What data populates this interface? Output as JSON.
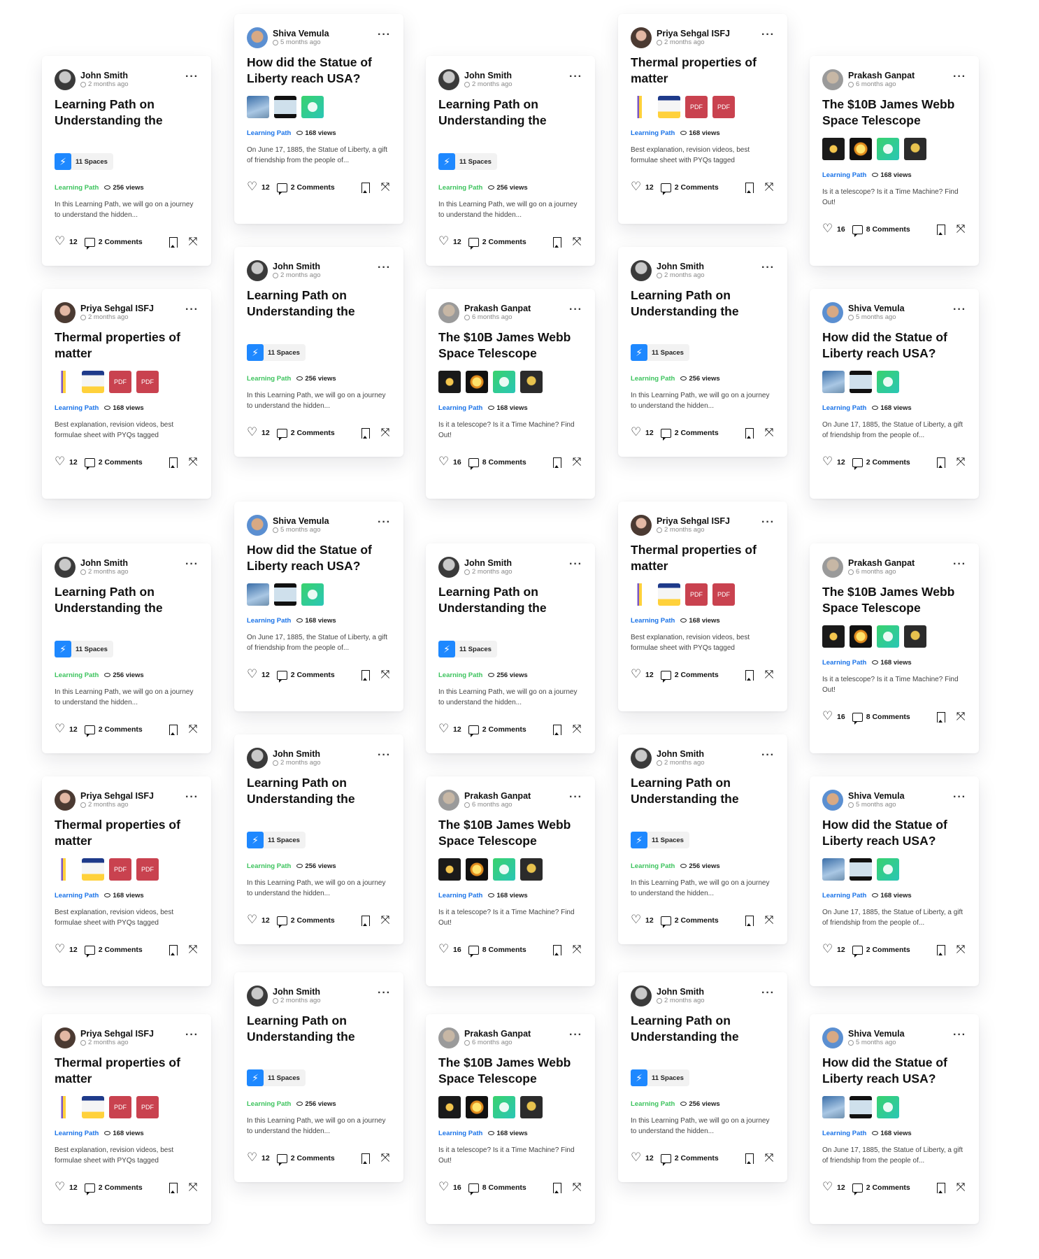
{
  "palette": {
    "learning_green": "#3cc35d",
    "learning_blue": "#1a73e8",
    "pdf_red": "#c9424f",
    "bolt_blue": "#1e88ff"
  },
  "variants": {
    "john": {
      "author": "John Smith",
      "time": "2 months ago",
      "avatar": "john-avatar",
      "title": "Learning Path on Understanding the",
      "media": "spaces",
      "spaces_label": "11 Spaces",
      "type_label": "Learning Path",
      "type_color": "#3cc35d",
      "views": "256 views",
      "desc": "In this Learning Path, we will go on a journey to understand the hidden...",
      "likes": "12",
      "comments": "2 Comments"
    },
    "shiva": {
      "author": "Shiva Vemula",
      "time": "5 months ago",
      "avatar": "shiva-avatar",
      "title": "How did the Statue of Liberty reach USA?",
      "media": "statue",
      "thumbs": [
        "statue-photo",
        "statue-photo-2",
        "bulb-icon"
      ],
      "type_label": "Learning Path",
      "type_color": "#1a73e8",
      "views": "168 views",
      "desc": "On June 17, 1885, the Statue of Liberty, a gift of friendship from the people of...",
      "likes": "12",
      "comments": "2 Comments"
    },
    "priya": {
      "author": "Priya Sehgal ISFJ",
      "time": "2 months ago",
      "avatar": "priya-avatar",
      "title": "Thermal properties of matter",
      "media": "thermal",
      "thumbs": [
        "book-cover",
        "physics-book-cover",
        "pdf-file",
        "pdf-file"
      ],
      "pdf_label": "PDF",
      "type_label": "Learning Path",
      "type_color": "#1a73e8",
      "views": "168 views",
      "desc": "Best explanation, revision videos, best formulae sheet with PYQs tagged",
      "likes": "12",
      "comments": "2 Comments"
    },
    "prakash": {
      "author": "Prakash Ganpat",
      "time": "6 months ago",
      "avatar": "prakash-avatar",
      "title": "The $10B James Webb Space Telescope",
      "media": "webb",
      "thumbs": [
        "mirror-image",
        "sun-image",
        "bulb-icon",
        "star-image"
      ],
      "type_label": "Learning Path",
      "type_color": "#1a73e8",
      "views": "168 views",
      "desc": "Is it a telescope? Is it a Time Machine? Find Out!",
      "likes": "16",
      "comments": "8 Comments"
    }
  },
  "columns": [
    [
      "john",
      "priya",
      "john",
      "priya",
      "priya"
    ],
    [
      "shiva",
      "john",
      "shiva",
      "john",
      "john"
    ],
    [
      "john",
      "prakash",
      "john",
      "prakash",
      "prakash"
    ],
    [
      "priya",
      "john",
      "priya",
      "john",
      "john"
    ],
    [
      "prakash",
      "shiva",
      "prakash",
      "shiva",
      "shiva"
    ]
  ]
}
